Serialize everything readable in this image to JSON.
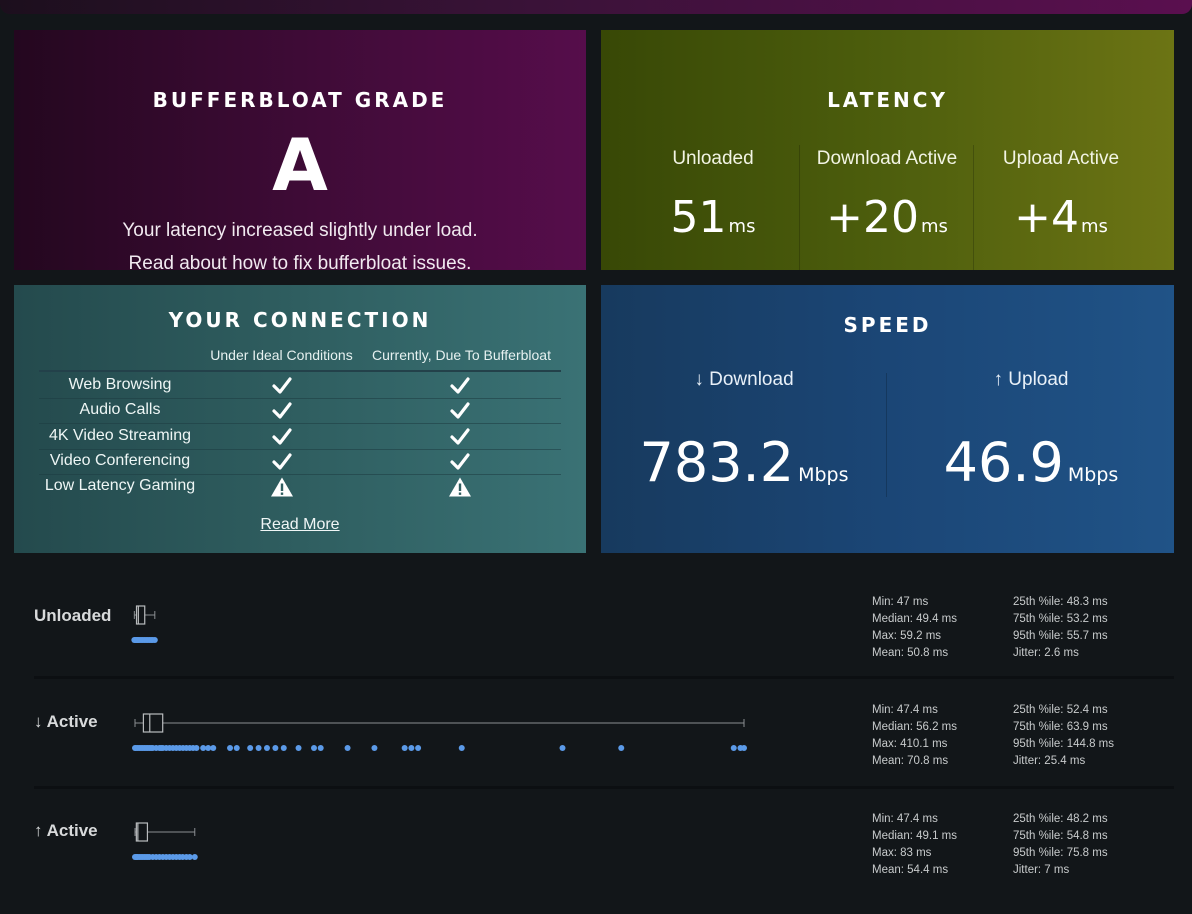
{
  "grade": {
    "title": "BUFFERBLOAT GRADE",
    "letter": "A",
    "text": "Your latency increased slightly under load.",
    "read_prefix": "Read about ",
    "read_link": "how to fix bufferbloat issues."
  },
  "latency": {
    "title": "LATENCY",
    "unit": "ms",
    "cols": [
      {
        "label": "Unloaded",
        "value": "51"
      },
      {
        "label": "Download Active",
        "value": "+20"
      },
      {
        "label": "Upload Active",
        "value": "+4"
      }
    ]
  },
  "connection": {
    "title": "YOUR CONNECTION",
    "col1": "Under Ideal Conditions",
    "col2": "Currently, Due To Bufferbloat",
    "rows": [
      {
        "label": "Web Browsing",
        "ideal": "check",
        "current": "check"
      },
      {
        "label": "Audio Calls",
        "ideal": "check",
        "current": "check"
      },
      {
        "label": "4K Video Streaming",
        "ideal": "check",
        "current": "check"
      },
      {
        "label": "Video Conferencing",
        "ideal": "check",
        "current": "check"
      },
      {
        "label": "Low Latency Gaming",
        "ideal": "warning",
        "current": "warning"
      }
    ],
    "read_more": "Read More"
  },
  "speed": {
    "title": "SPEED",
    "unit": "Mbps",
    "download_label": "↓ Download",
    "download_value": "783.2",
    "upload_label": "↑ Upload",
    "upload_value": "46.9"
  },
  "boxplots": [
    {
      "label": "Unloaded",
      "min": 47,
      "q1": 48.3,
      "median": 49.4,
      "q3": 53.2,
      "max": 59.2,
      "points": [
        47,
        47.5,
        48,
        48.3,
        48.6,
        49,
        49.4,
        50,
        51,
        52,
        53,
        54,
        55,
        56,
        57,
        58,
        59.2
      ],
      "stats_left": [
        "Min: 47 ms",
        "Median: 49.4 ms",
        "Max: 59.2 ms",
        "Mean: 50.8 ms"
      ],
      "stats_right": [
        "25th %ile: 48.3 ms",
        "75th %ile: 53.2 ms",
        "95th %ile: 55.7 ms",
        "Jitter: 2.6 ms"
      ]
    },
    {
      "label": "↓ Active",
      "min": 47.4,
      "q1": 52.4,
      "median": 56.2,
      "q3": 63.9,
      "max": 410.1,
      "points": [
        47.4,
        48,
        49,
        50,
        51,
        52,
        53,
        54,
        55,
        56,
        57,
        58,
        60,
        62,
        63,
        64,
        66,
        68,
        70,
        72,
        74,
        76,
        78,
        80,
        82,
        84,
        88,
        91,
        94,
        104,
        108,
        116,
        121,
        126,
        131,
        136,
        144.8,
        154,
        158,
        174,
        190,
        208,
        212,
        216,
        242,
        302,
        337,
        404,
        408,
        410.1
      ],
      "stats_left": [
        "Min: 47.4 ms",
        "Median: 56.2 ms",
        "Max: 410.1 ms",
        "Mean: 70.8 ms"
      ],
      "stats_right": [
        "25th %ile: 52.4 ms",
        "75th %ile: 63.9 ms",
        "95th %ile: 144.8 ms",
        "Jitter: 25.4 ms"
      ]
    },
    {
      "label": "↑ Active",
      "min": 47.4,
      "q1": 48.2,
      "median": 49.1,
      "q3": 54.8,
      "max": 83,
      "points": [
        47.4,
        48,
        48.5,
        49,
        50,
        51,
        52,
        53,
        54,
        55,
        56,
        58,
        60,
        62,
        64,
        66,
        68,
        70,
        72,
        74,
        75.8,
        78,
        80,
        83
      ],
      "stats_left": [
        "Min: 47.4 ms",
        "Median: 49.1 ms",
        "Max: 83 ms",
        "Mean: 54.4 ms"
      ],
      "stats_right": [
        "25th %ile: 48.2 ms",
        "75th %ile: 54.8 ms",
        "95th %ile: 75.8 ms",
        "Jitter: 7 ms"
      ]
    }
  ],
  "colors": {
    "point": "#5b9ae8",
    "box_stroke": "#b9bcbe",
    "whisker": "#8a8e91"
  }
}
